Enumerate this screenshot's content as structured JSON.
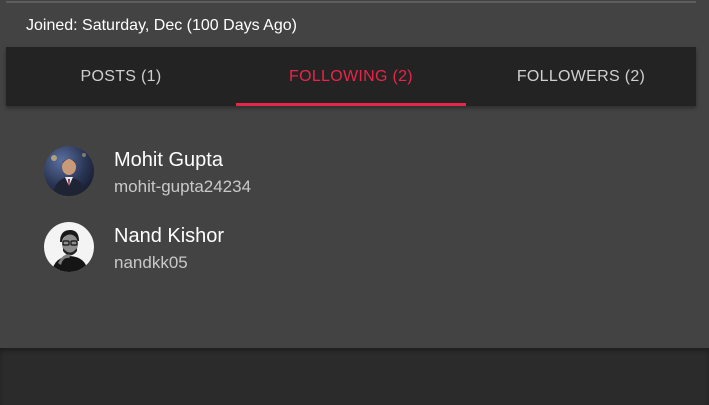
{
  "profile": {
    "joined_text": "Joined: Saturday, Dec (100 Days Ago)"
  },
  "tabs": [
    {
      "label": "POSTS (1)",
      "active": false
    },
    {
      "label": "FOLLOWING (2)",
      "active": true
    },
    {
      "label": "FOLLOWERS (2)",
      "active": false
    }
  ],
  "following": [
    {
      "name": "Mohit Gupta",
      "handle": "mohit-gupta24234",
      "avatar": "user-photo-icon"
    },
    {
      "name": "Nand Kishor",
      "handle": "nandkk05",
      "avatar": "user-photo-icon"
    }
  ],
  "colors": {
    "accent": "#e8254a",
    "card_background": "#434343",
    "tab_bar_background": "#232323",
    "page_background": "#2b2b2b"
  }
}
